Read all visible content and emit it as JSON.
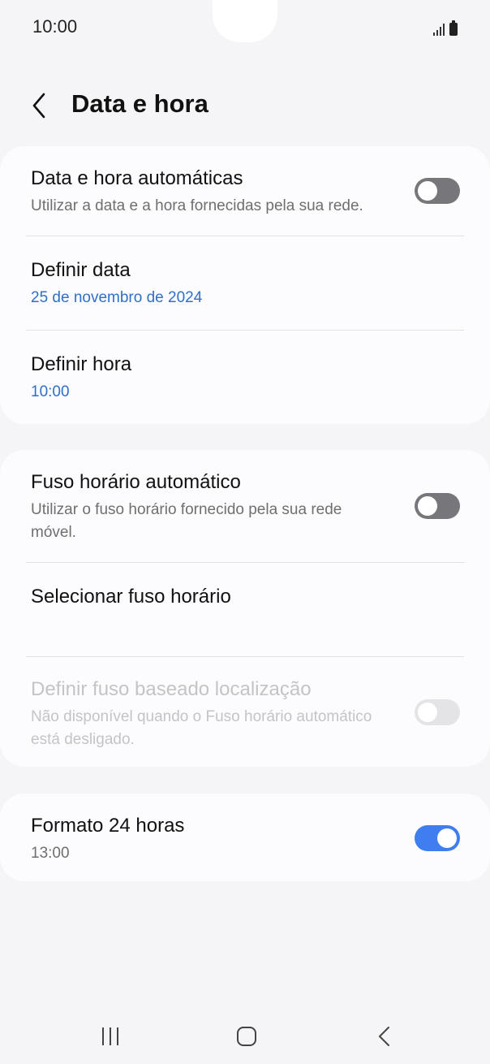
{
  "status_bar": {
    "time": "10:00"
  },
  "header": {
    "title": "Data e hora"
  },
  "card1": {
    "auto_datetime": {
      "title": "Data e hora automáticas",
      "subtitle": "Utilizar a data e a hora fornecidas pela sua rede.",
      "toggle": "off"
    },
    "set_date": {
      "title": "Definir data",
      "value": "25 de novembro de 2024"
    },
    "set_time": {
      "title": "Definir hora",
      "value": "10:00"
    }
  },
  "card2": {
    "auto_timezone": {
      "title": "Fuso horário automático",
      "subtitle": "Utilizar o fuso horário fornecido pela sua rede móvel.",
      "toggle": "off"
    },
    "select_timezone": {
      "title": "Selecionar fuso horário"
    },
    "location_timezone": {
      "title": "Definir fuso baseado localização",
      "subtitle": "Não disponível quando o Fuso horário automático está desligado.",
      "toggle": "off",
      "enabled": false
    }
  },
  "card3": {
    "format_24h": {
      "title": "Formato 24 horas",
      "subtitle": "13:00",
      "toggle": "on"
    }
  },
  "colors": {
    "accent": "#3f7ef0",
    "link": "#2f6fc9",
    "background": "#f5f5f7",
    "card": "#fcfcfe"
  }
}
